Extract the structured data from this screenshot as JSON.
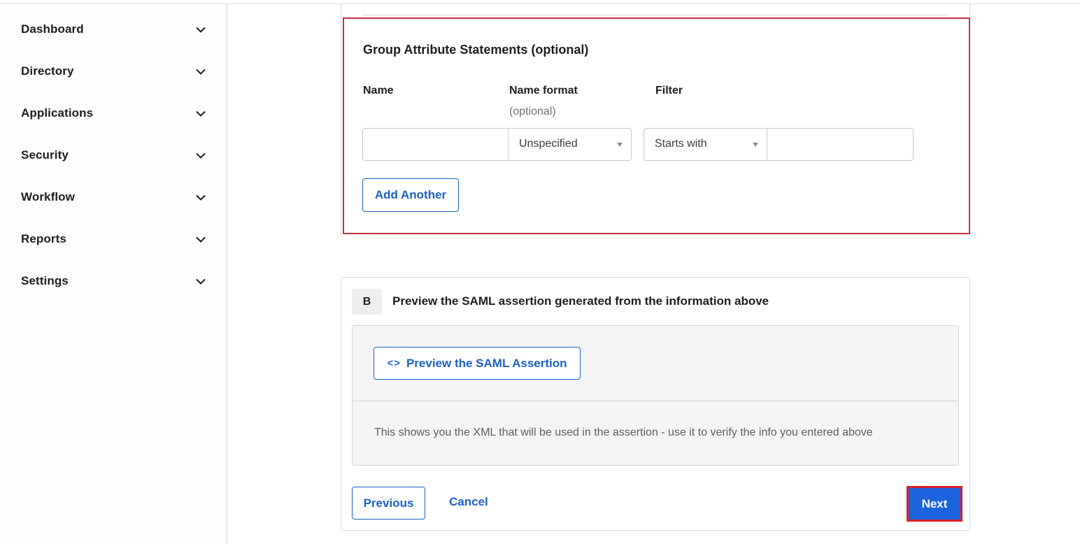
{
  "sidebar": {
    "items": [
      {
        "label": "Dashboard",
        "icon": "chevron-down-icon"
      },
      {
        "label": "Directory",
        "icon": "chevron-down-icon"
      },
      {
        "label": "Applications",
        "icon": "chevron-down-icon"
      },
      {
        "label": "Security",
        "icon": "chevron-down-icon"
      },
      {
        "label": "Workflow",
        "icon": "chevron-down-icon"
      },
      {
        "label": "Reports",
        "icon": "chevron-down-icon"
      },
      {
        "label": "Settings",
        "icon": "chevron-down-icon"
      }
    ]
  },
  "group_attributes": {
    "title": "Group Attribute Statements (optional)",
    "columns": {
      "name": "Name",
      "name_format": "Name format",
      "name_format_sub": "(optional)",
      "filter": "Filter"
    },
    "row": {
      "name_value": "",
      "name_format_value": "Unspecified",
      "filter_type_value": "Starts with",
      "filter_value": ""
    },
    "add_another_label": "Add Another"
  },
  "section_b": {
    "badge": "B",
    "title": "Preview the SAML assertion generated from the information above",
    "preview_button_icon": "<>",
    "preview_button_label": "Preview the SAML Assertion",
    "description": "This shows you the XML that will be used in the assertion - use it to verify the info you entered above"
  },
  "footer": {
    "previous_label": "Previous",
    "cancel_label": "Cancel",
    "next_label": "Next"
  },
  "colors": {
    "accent": "#1d5fc7",
    "primary_button": "#1d63dc",
    "highlight": "#c4323f"
  }
}
